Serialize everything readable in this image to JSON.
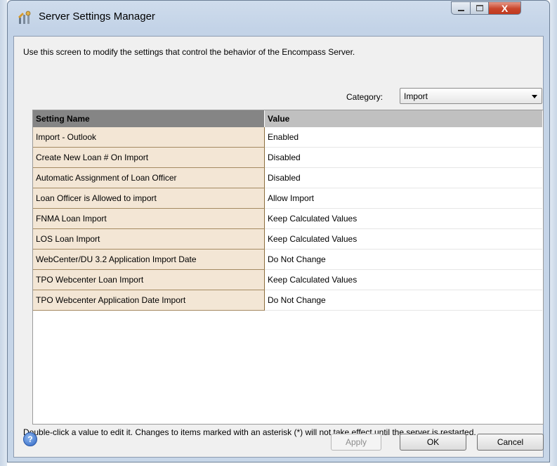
{
  "window": {
    "title": "Server Settings Manager",
    "close_glyph": "X",
    "app_icon": "settings-wrench-icon"
  },
  "description": "Use this screen to modify the settings that control the behavior of the Encompass Server.",
  "category": {
    "label": "Category:",
    "value": "Import"
  },
  "grid": {
    "headers": {
      "name": "Setting Name",
      "value": "Value"
    },
    "rows": [
      {
        "name": "Import - Outlook",
        "value": "Enabled"
      },
      {
        "name": "Create New Loan # On Import",
        "value": "Disabled"
      },
      {
        "name": "Automatic Assignment of Loan Officer",
        "value": "Disabled"
      },
      {
        "name": "Loan Officer is Allowed to import",
        "value": "Allow Import"
      },
      {
        "name": "FNMA Loan Import",
        "value": "Keep Calculated Values"
      },
      {
        "name": "LOS Loan Import",
        "value": "Keep Calculated Values"
      },
      {
        "name": "WebCenter/DU 3.2 Application Import Date",
        "value": "Do Not Change"
      },
      {
        "name": "TPO Webcenter Loan Import",
        "value": "Keep Calculated Values"
      },
      {
        "name": "TPO Webcenter Application Date Import",
        "value": "Do Not Change"
      }
    ]
  },
  "hint": "Double-click a value to edit it. Changes to items marked with an asterisk (*) will not take effect until the server is restarted.",
  "footer": {
    "help_glyph": "?",
    "apply_label": "Apply",
    "ok_label": "OK",
    "cancel_label": "Cancel"
  },
  "colors": {
    "name_cell_bg": "#f3e6d5",
    "header_dark": "#858585",
    "header_light": "#c0c0c0",
    "dialog_bg": "#f0f0f0"
  }
}
